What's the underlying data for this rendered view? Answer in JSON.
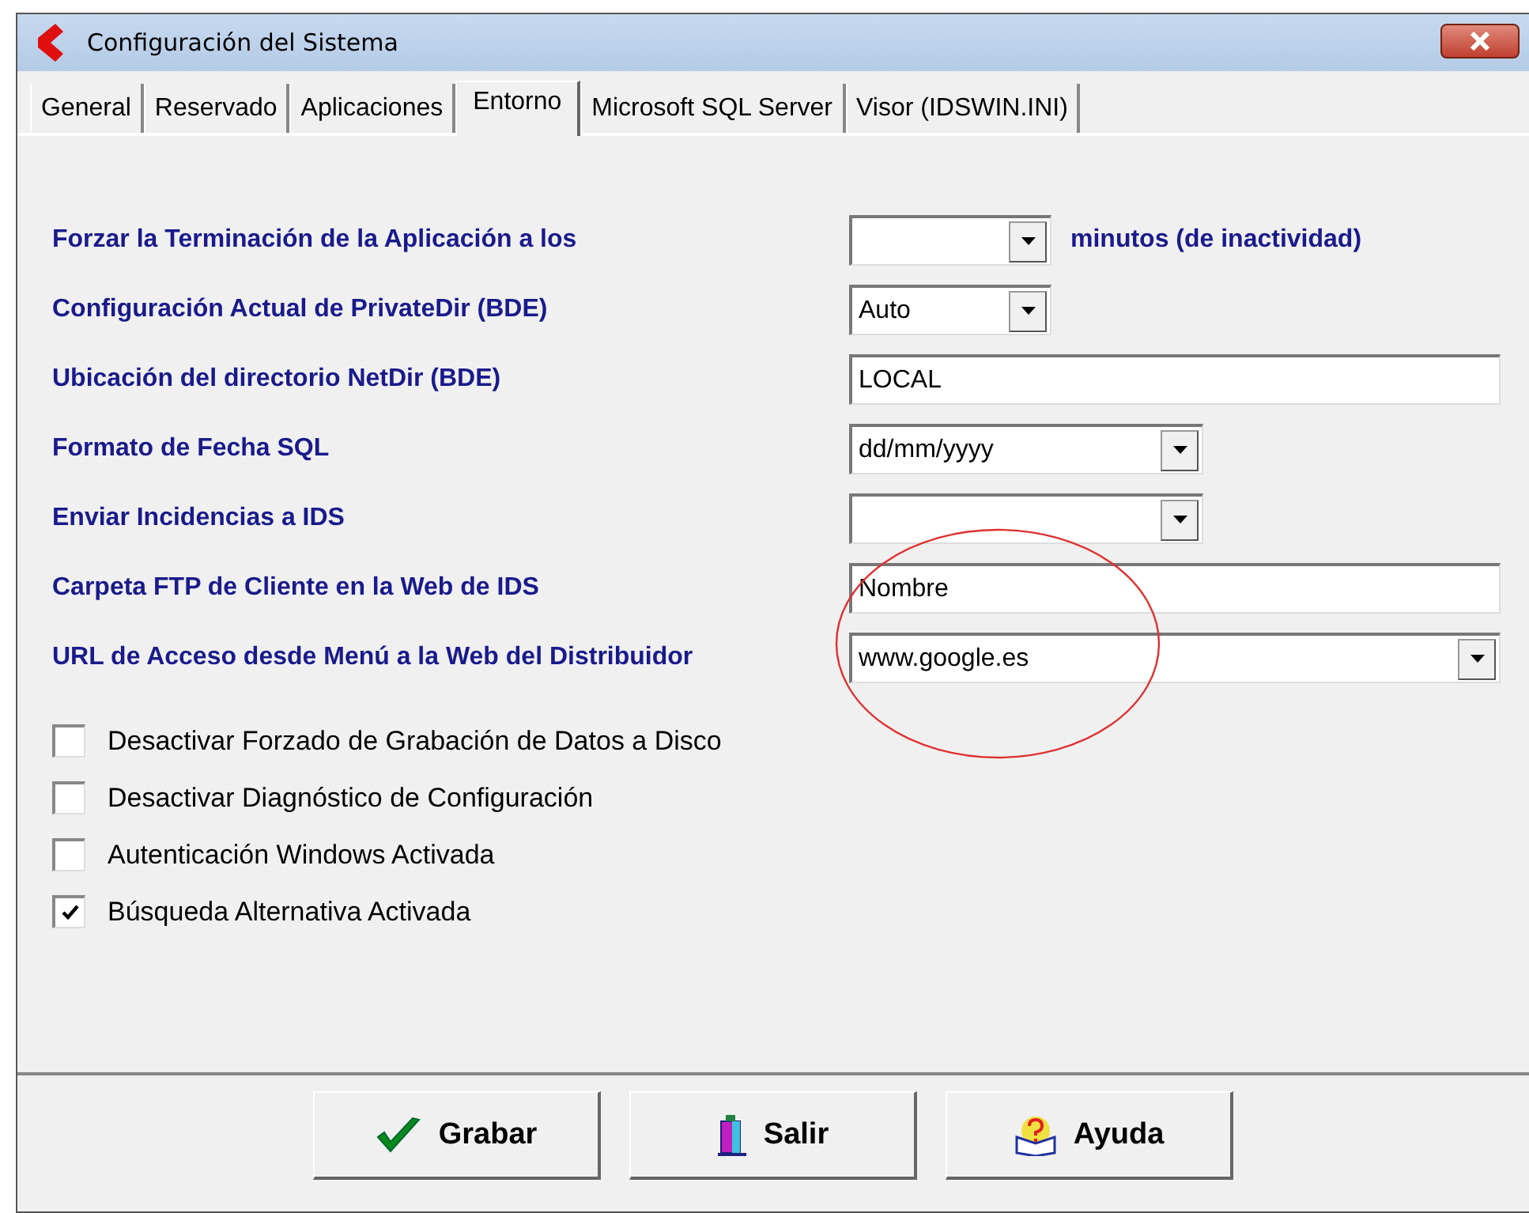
{
  "window": {
    "title": "Configuración del Sistema"
  },
  "tabs": [
    {
      "label": "General",
      "selected": false
    },
    {
      "label": "Reservado",
      "selected": false
    },
    {
      "label": "Aplicaciones",
      "selected": false
    },
    {
      "label": "Entorno",
      "selected": true
    },
    {
      "label": "Microsoft SQL Server",
      "selected": false
    },
    {
      "label": "Visor (IDSWIN.INI)",
      "selected": false
    }
  ],
  "fields": [
    {
      "label": "Forzar la Terminación de la Aplicación a los",
      "kind": "combo",
      "suffix": "minutos (de inactividad)"
    },
    {
      "label": "Configuración Actual de PrivateDir (BDE)",
      "kind": "combo",
      "value": "Auto"
    },
    {
      "label": "Ubicación del directorio NetDir (BDE)",
      "kind": "text",
      "value": "LOCAL"
    },
    {
      "label": "Formato de Fecha SQL",
      "kind": "combo",
      "value": "dd/mm/yyyy"
    },
    {
      "label": "Enviar Incidencias a IDS",
      "kind": "combo"
    },
    {
      "label": "Carpeta FTP de Cliente en la Web de IDS",
      "kind": "text",
      "value": "Nombre"
    },
    {
      "label": "URL de Acceso desde Menú a la Web del Distribuidor",
      "kind": "combo",
      "value": "www.google.es"
    }
  ],
  "checkboxes": [
    {
      "label": "Desactivar Forzado de Grabación de Datos a Disco",
      "checked": false
    },
    {
      "label": "Desactivar Diagnóstico de Configuración",
      "checked": false
    },
    {
      "label": "Autenticación Windows Activada",
      "checked": false
    },
    {
      "label": "Búsqueda Alternativa Activada",
      "checked": true
    }
  ],
  "buttons": [
    {
      "label": "Grabar",
      "kind": "save"
    },
    {
      "label": "Salir",
      "kind": "exit"
    },
    {
      "label": "Ayuda",
      "kind": "help"
    }
  ]
}
